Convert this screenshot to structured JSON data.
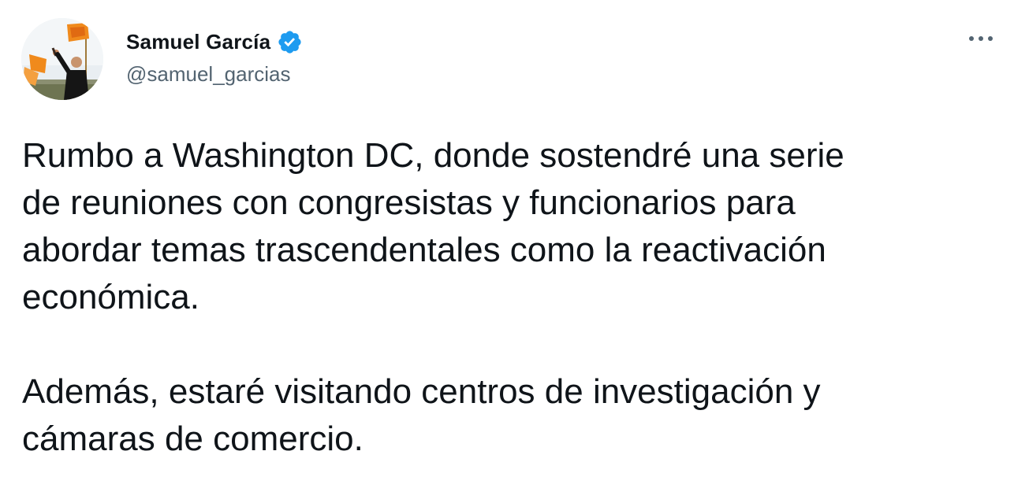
{
  "author": {
    "display_name": "Samuel García",
    "handle": "@samuel_garcias",
    "verified": true,
    "verified_icon": "verified-badge-icon",
    "verified_color": "#1d9bf0"
  },
  "tweet": {
    "paragraphs": [
      "Rumbo a Washington DC, donde sostendré una serie\nde reuniones con congresistas y funcionarios para\nabordar temas trascendentales como la reactivación\neconómica.",
      "Además, estaré visitando centros de investigación y\ncámaras de comercio."
    ]
  },
  "more_icon": "more-options-icon",
  "colors": {
    "text_primary": "#0f1419",
    "text_secondary": "#536471"
  }
}
